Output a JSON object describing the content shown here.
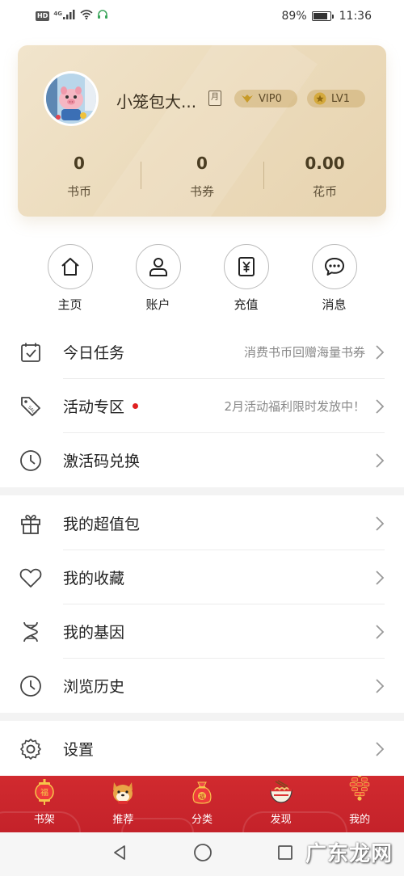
{
  "status_bar": {
    "network_badge": "HD",
    "signal_label": "4G",
    "battery_percent": "89%",
    "battery_level": 0.89,
    "time": "11:36",
    "icons": [
      "hd-icon",
      "signal-icon",
      "wifi-icon",
      "headset-icon",
      "battery-icon"
    ]
  },
  "profile": {
    "username": "小笼包大...",
    "month_badge": "月",
    "vip_label": "VIP0",
    "level_label": "LV1",
    "stats": [
      {
        "value": "0",
        "label": "书币"
      },
      {
        "value": "0",
        "label": "书券"
      },
      {
        "value": "0.00",
        "label": "花币"
      }
    ]
  },
  "quick_actions": [
    {
      "label": "主页",
      "icon": "home-icon"
    },
    {
      "label": "账户",
      "icon": "user-icon"
    },
    {
      "label": "充值",
      "icon": "yuan-icon"
    },
    {
      "label": "消息",
      "icon": "chat-icon"
    }
  ],
  "menu_group_1": [
    {
      "label": "今日任务",
      "desc": "消费书币回赠海量书券",
      "icon": "calendar-check-icon"
    },
    {
      "label": "活动专区",
      "desc": "2月活动福利限时发放中！",
      "icon": "sale-tag-icon",
      "has_dot": true
    },
    {
      "label": "激活码兑换",
      "desc": "",
      "icon": "clock-icon"
    }
  ],
  "menu_group_2": [
    {
      "label": "我的超值包",
      "icon": "gift-icon"
    },
    {
      "label": "我的收藏",
      "icon": "heart-icon"
    },
    {
      "label": "我的基因",
      "icon": "dna-icon"
    },
    {
      "label": "浏览历史",
      "icon": "history-clock-icon"
    }
  ],
  "menu_group_3": [
    {
      "label": "设置",
      "icon": "settings-gear-icon"
    }
  ],
  "tab_bar": {
    "tabs": [
      {
        "label": "书架",
        "icon": "lantern-icon"
      },
      {
        "label": "推荐",
        "icon": "shiba-dog-icon"
      },
      {
        "label": "分类",
        "icon": "lucky-bag-icon"
      },
      {
        "label": "发现",
        "icon": "noodle-bowl-icon"
      },
      {
        "label": "我的",
        "icon": "firecracker-icon"
      }
    ],
    "active_index": 4,
    "colors": {
      "background": "#d12a2f",
      "label": "#ffffff"
    }
  },
  "nav_bar": {
    "buttons": [
      "back-triangle-icon",
      "home-circle-icon",
      "recents-square-icon"
    ]
  },
  "watermark": "广东龙网",
  "theme": {
    "card_gold": "#ecdcbd",
    "accent_red": "#e02020",
    "text_primary": "#222222",
    "text_secondary": "#888888"
  }
}
